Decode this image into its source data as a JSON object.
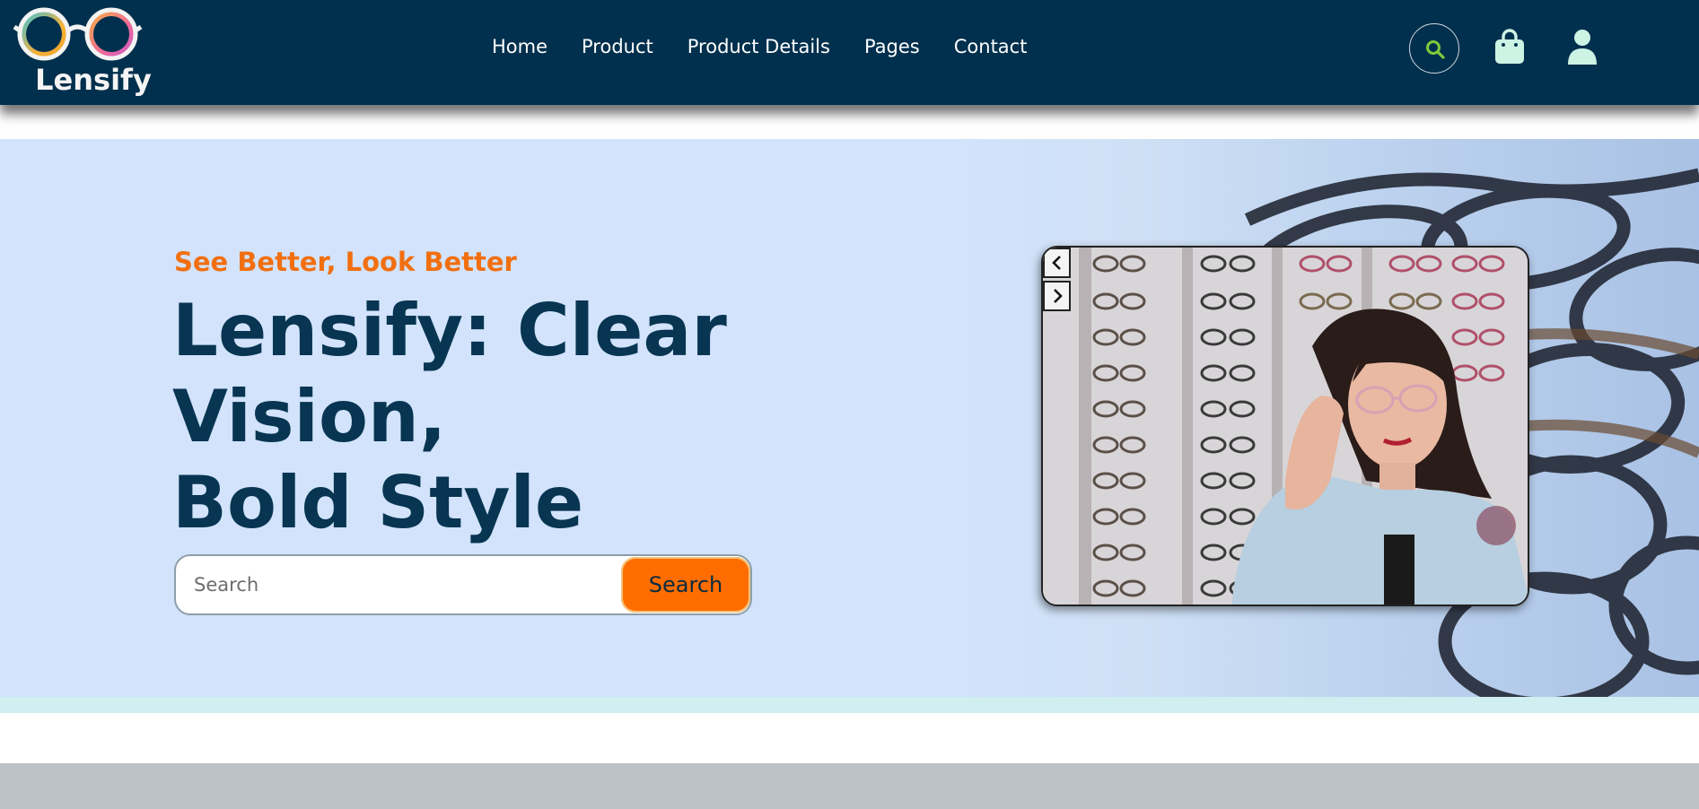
{
  "brand": {
    "name": "Lensify"
  },
  "nav": {
    "links": [
      "Home",
      "Product",
      "Product Details",
      "Pages",
      "Contact"
    ]
  },
  "header_icons": {
    "search": "search-icon",
    "bag": "shopping-bag-icon",
    "user": "user-icon"
  },
  "hero": {
    "tagline": "See Better, Look Better",
    "headline_line1": "Lensify: Clear",
    "headline_line2": "Vision,",
    "headline_line3": "Bold Style",
    "search": {
      "placeholder": "Search",
      "value": "",
      "button_label": "Search"
    },
    "carousel": {
      "prev_icon": "chevron-left-icon",
      "next_icon": "chevron-right-icon"
    }
  },
  "colors": {
    "navbar": "#00304d",
    "hero_bg": "#d2e3fb",
    "accent": "#ff6d00",
    "tagline": "#f26f10",
    "headline": "#073552"
  }
}
